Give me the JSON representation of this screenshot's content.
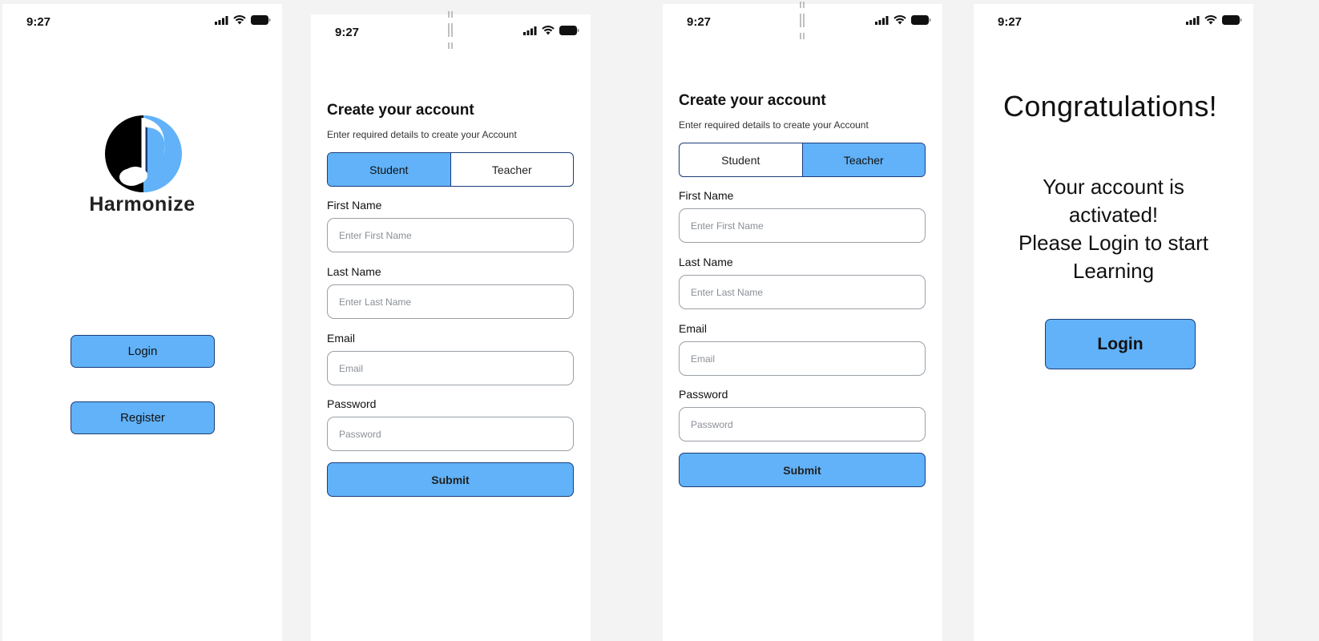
{
  "status": {
    "time": "9:27"
  },
  "brand": {
    "name": "Harmonize",
    "accent": "#61b2f8",
    "border": "#1b3d7a"
  },
  "welcome": {
    "login_label": "Login",
    "register_label": "Register"
  },
  "form": {
    "title": "Create your account",
    "subtitle": "Enter required details to create your Account",
    "roles": [
      "Student",
      "Teacher"
    ],
    "fields": {
      "first_name": {
        "label": "First Name",
        "placeholder": "Enter First Name"
      },
      "last_name": {
        "label": "Last Name",
        "placeholder": "Enter Last Name"
      },
      "email": {
        "label": "Email",
        "placeholder": "Email"
      },
      "password": {
        "label": "Password",
        "placeholder": "Password"
      }
    },
    "submit_label": "Submit"
  },
  "screen2": {
    "selected_role": "Student"
  },
  "screen3": {
    "selected_role": "Teacher"
  },
  "success": {
    "heading": "Congratulations!",
    "line1": "Your account is",
    "line2": "activated!",
    "line3": "Please Login to start",
    "line4": "Learning",
    "login_label": "Login"
  }
}
